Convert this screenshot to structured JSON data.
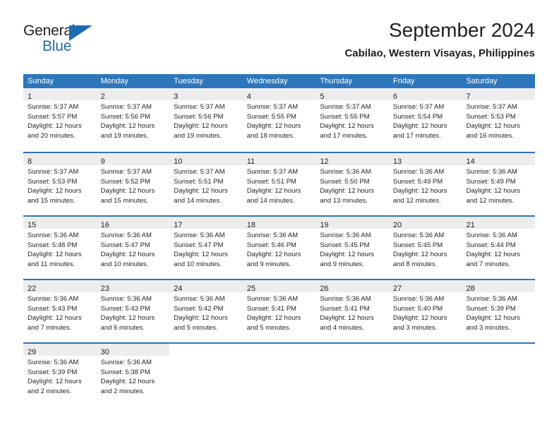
{
  "brand": {
    "word_top": "General",
    "word_bottom": "Blue",
    "flag_icon": "blue-triangle-flag-icon"
  },
  "header": {
    "title": "September 2024",
    "subtitle": "Cabilao, Western Visayas, Philippines"
  },
  "colors": {
    "header_blue": "#2d76bb",
    "brand_blue": "#1f6bb0",
    "day_band_gray": "#ededed",
    "text": "#231f20"
  },
  "weekdays": [
    "Sunday",
    "Monday",
    "Tuesday",
    "Wednesday",
    "Thursday",
    "Friday",
    "Saturday"
  ],
  "weeks": [
    [
      {
        "day": "1",
        "sunrise": "Sunrise: 5:37 AM",
        "sunset": "Sunset: 5:57 PM",
        "daylight1": "Daylight: 12 hours",
        "daylight2": "and 20 minutes."
      },
      {
        "day": "2",
        "sunrise": "Sunrise: 5:37 AM",
        "sunset": "Sunset: 5:56 PM",
        "daylight1": "Daylight: 12 hours",
        "daylight2": "and 19 minutes."
      },
      {
        "day": "3",
        "sunrise": "Sunrise: 5:37 AM",
        "sunset": "Sunset: 5:56 PM",
        "daylight1": "Daylight: 12 hours",
        "daylight2": "and 19 minutes."
      },
      {
        "day": "4",
        "sunrise": "Sunrise: 5:37 AM",
        "sunset": "Sunset: 5:55 PM",
        "daylight1": "Daylight: 12 hours",
        "daylight2": "and 18 minutes."
      },
      {
        "day": "5",
        "sunrise": "Sunrise: 5:37 AM",
        "sunset": "Sunset: 5:55 PM",
        "daylight1": "Daylight: 12 hours",
        "daylight2": "and 17 minutes."
      },
      {
        "day": "6",
        "sunrise": "Sunrise: 5:37 AM",
        "sunset": "Sunset: 5:54 PM",
        "daylight1": "Daylight: 12 hours",
        "daylight2": "and 17 minutes."
      },
      {
        "day": "7",
        "sunrise": "Sunrise: 5:37 AM",
        "sunset": "Sunset: 5:53 PM",
        "daylight1": "Daylight: 12 hours",
        "daylight2": "and 16 minutes."
      }
    ],
    [
      {
        "day": "8",
        "sunrise": "Sunrise: 5:37 AM",
        "sunset": "Sunset: 5:53 PM",
        "daylight1": "Daylight: 12 hours",
        "daylight2": "and 15 minutes."
      },
      {
        "day": "9",
        "sunrise": "Sunrise: 5:37 AM",
        "sunset": "Sunset: 5:52 PM",
        "daylight1": "Daylight: 12 hours",
        "daylight2": "and 15 minutes."
      },
      {
        "day": "10",
        "sunrise": "Sunrise: 5:37 AM",
        "sunset": "Sunset: 5:51 PM",
        "daylight1": "Daylight: 12 hours",
        "daylight2": "and 14 minutes."
      },
      {
        "day": "11",
        "sunrise": "Sunrise: 5:37 AM",
        "sunset": "Sunset: 5:51 PM",
        "daylight1": "Daylight: 12 hours",
        "daylight2": "and 14 minutes."
      },
      {
        "day": "12",
        "sunrise": "Sunrise: 5:36 AM",
        "sunset": "Sunset: 5:50 PM",
        "daylight1": "Daylight: 12 hours",
        "daylight2": "and 13 minutes."
      },
      {
        "day": "13",
        "sunrise": "Sunrise: 5:36 AM",
        "sunset": "Sunset: 5:49 PM",
        "daylight1": "Daylight: 12 hours",
        "daylight2": "and 12 minutes."
      },
      {
        "day": "14",
        "sunrise": "Sunrise: 5:36 AM",
        "sunset": "Sunset: 5:49 PM",
        "daylight1": "Daylight: 12 hours",
        "daylight2": "and 12 minutes."
      }
    ],
    [
      {
        "day": "15",
        "sunrise": "Sunrise: 5:36 AM",
        "sunset": "Sunset: 5:48 PM",
        "daylight1": "Daylight: 12 hours",
        "daylight2": "and 11 minutes."
      },
      {
        "day": "16",
        "sunrise": "Sunrise: 5:36 AM",
        "sunset": "Sunset: 5:47 PM",
        "daylight1": "Daylight: 12 hours",
        "daylight2": "and 10 minutes."
      },
      {
        "day": "17",
        "sunrise": "Sunrise: 5:36 AM",
        "sunset": "Sunset: 5:47 PM",
        "daylight1": "Daylight: 12 hours",
        "daylight2": "and 10 minutes."
      },
      {
        "day": "18",
        "sunrise": "Sunrise: 5:36 AM",
        "sunset": "Sunset: 5:46 PM",
        "daylight1": "Daylight: 12 hours",
        "daylight2": "and 9 minutes."
      },
      {
        "day": "19",
        "sunrise": "Sunrise: 5:36 AM",
        "sunset": "Sunset: 5:45 PM",
        "daylight1": "Daylight: 12 hours",
        "daylight2": "and 9 minutes."
      },
      {
        "day": "20",
        "sunrise": "Sunrise: 5:36 AM",
        "sunset": "Sunset: 5:45 PM",
        "daylight1": "Daylight: 12 hours",
        "daylight2": "and 8 minutes."
      },
      {
        "day": "21",
        "sunrise": "Sunrise: 5:36 AM",
        "sunset": "Sunset: 5:44 PM",
        "daylight1": "Daylight: 12 hours",
        "daylight2": "and 7 minutes."
      }
    ],
    [
      {
        "day": "22",
        "sunrise": "Sunrise: 5:36 AM",
        "sunset": "Sunset: 5:43 PM",
        "daylight1": "Daylight: 12 hours",
        "daylight2": "and 7 minutes."
      },
      {
        "day": "23",
        "sunrise": "Sunrise: 5:36 AM",
        "sunset": "Sunset: 5:43 PM",
        "daylight1": "Daylight: 12 hours",
        "daylight2": "and 6 minutes."
      },
      {
        "day": "24",
        "sunrise": "Sunrise: 5:36 AM",
        "sunset": "Sunset: 5:42 PM",
        "daylight1": "Daylight: 12 hours",
        "daylight2": "and 5 minutes."
      },
      {
        "day": "25",
        "sunrise": "Sunrise: 5:36 AM",
        "sunset": "Sunset: 5:41 PM",
        "daylight1": "Daylight: 12 hours",
        "daylight2": "and 5 minutes."
      },
      {
        "day": "26",
        "sunrise": "Sunrise: 5:36 AM",
        "sunset": "Sunset: 5:41 PM",
        "daylight1": "Daylight: 12 hours",
        "daylight2": "and 4 minutes."
      },
      {
        "day": "27",
        "sunrise": "Sunrise: 5:36 AM",
        "sunset": "Sunset: 5:40 PM",
        "daylight1": "Daylight: 12 hours",
        "daylight2": "and 3 minutes."
      },
      {
        "day": "28",
        "sunrise": "Sunrise: 5:36 AM",
        "sunset": "Sunset: 5:39 PM",
        "daylight1": "Daylight: 12 hours",
        "daylight2": "and 3 minutes."
      }
    ],
    [
      {
        "day": "29",
        "sunrise": "Sunrise: 5:36 AM",
        "sunset": "Sunset: 5:39 PM",
        "daylight1": "Daylight: 12 hours",
        "daylight2": "and 2 minutes."
      },
      {
        "day": "30",
        "sunrise": "Sunrise: 5:36 AM",
        "sunset": "Sunset: 5:38 PM",
        "daylight1": "Daylight: 12 hours",
        "daylight2": "and 2 minutes."
      },
      {
        "day": "",
        "sunrise": "",
        "sunset": "",
        "daylight1": "",
        "daylight2": ""
      },
      {
        "day": "",
        "sunrise": "",
        "sunset": "",
        "daylight1": "",
        "daylight2": ""
      },
      {
        "day": "",
        "sunrise": "",
        "sunset": "",
        "daylight1": "",
        "daylight2": ""
      },
      {
        "day": "",
        "sunrise": "",
        "sunset": "",
        "daylight1": "",
        "daylight2": ""
      },
      {
        "day": "",
        "sunrise": "",
        "sunset": "",
        "daylight1": "",
        "daylight2": ""
      }
    ]
  ]
}
